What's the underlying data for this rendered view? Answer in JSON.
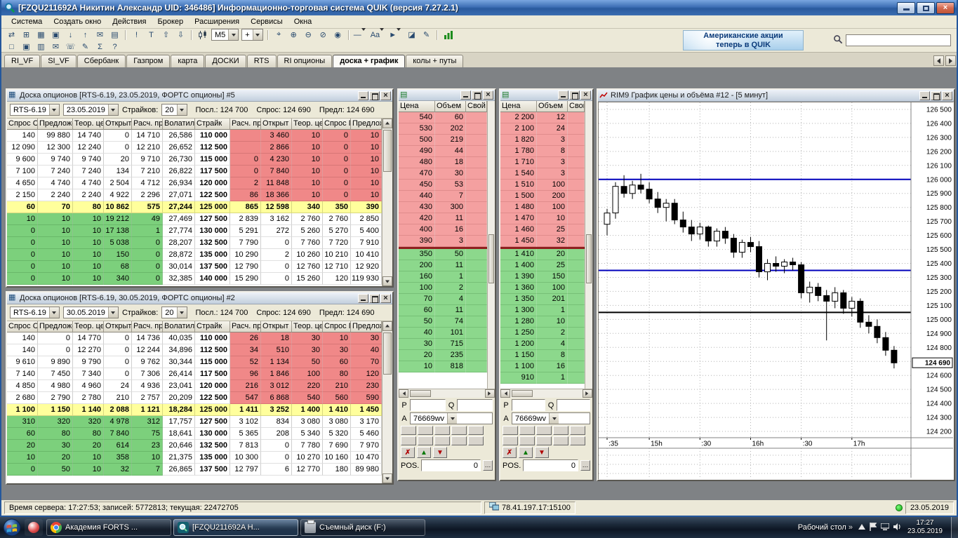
{
  "titlebar": {
    "title": "[FZQU211692A Никитин Александр UID: 346486] Информационно-торговая система QUIK (версия 7.27.2.1)"
  },
  "menubar": [
    "Система",
    "Создать окно",
    "Действия",
    "Брокер",
    "Расширения",
    "Сервисы",
    "Окна"
  ],
  "toolbar": {
    "banner_line1": "Американские акции",
    "banner_line2": "теперь в QUIK",
    "search_placeholder": "",
    "row1": [
      {
        "t": "icon",
        "name": "connection-icon",
        "g": "⇄"
      },
      {
        "t": "icon",
        "name": "new-table-icon",
        "g": "⊞"
      },
      {
        "t": "icon",
        "name": "open-table-icon",
        "g": "▦"
      },
      {
        "t": "icon",
        "name": "save-icon",
        "g": "▣"
      },
      {
        "t": "icon",
        "name": "export-data-icon",
        "g": "↓"
      },
      {
        "t": "icon",
        "name": "import-data-icon",
        "g": "↑"
      },
      {
        "t": "icon",
        "name": "mail-icon",
        "g": "✉"
      },
      {
        "t": "icon",
        "name": "print-icon",
        "g": "▤"
      },
      {
        "t": "sep"
      },
      {
        "t": "icon",
        "name": "info-icon",
        "g": "!"
      },
      {
        "t": "icon",
        "name": "text-format-icon",
        "g": "T"
      },
      {
        "t": "icon",
        "name": "like-icon",
        "g": "⇧"
      },
      {
        "t": "icon",
        "name": "dislike-icon",
        "g": "⇩"
      },
      {
        "t": "sep"
      },
      {
        "t": "svg",
        "name": "candlestick-chart-icon",
        "kind": "candles"
      },
      {
        "t": "combo",
        "name": "interval-select",
        "value": "M5"
      },
      {
        "t": "combo",
        "name": "add-study-select",
        "value": "+"
      },
      {
        "t": "sep"
      },
      {
        "t": "icon",
        "name": "crosshair-icon",
        "g": "⌖"
      },
      {
        "t": "icon",
        "name": "zoom-in-icon",
        "g": "⊕"
      },
      {
        "t": "icon",
        "name": "zoom-out-icon",
        "g": "⊖"
      },
      {
        "t": "icon",
        "name": "zoom-reset-icon",
        "g": "⊘"
      },
      {
        "t": "icon",
        "name": "pan-hand-icon",
        "g": "◉"
      },
      {
        "t": "sep"
      },
      {
        "t": "dropicon",
        "name": "line-tool-icon",
        "g": "—"
      },
      {
        "t": "dropicon",
        "name": "text-tool-icon",
        "g": "Aa"
      },
      {
        "t": "dropicon",
        "name": "pointer-tool-icon",
        "g": "►"
      },
      {
        "t": "icon",
        "name": "eraser-icon",
        "g": "◪"
      },
      {
        "t": "icon",
        "name": "pen-icon",
        "g": "✎"
      },
      {
        "t": "sep"
      },
      {
        "t": "svg",
        "name": "volume-bars-icon",
        "kind": "bars"
      }
    ],
    "row2": [
      {
        "t": "icon",
        "name": "new-window-icon",
        "g": "□"
      },
      {
        "t": "icon",
        "name": "cascade-windows-icon",
        "g": "▣"
      },
      {
        "t": "icon",
        "name": "tile-windows-icon",
        "g": "▥"
      },
      {
        "t": "icon",
        "name": "messages-icon",
        "g": "✉"
      },
      {
        "t": "icon",
        "name": "phone-icon",
        "g": "☏"
      },
      {
        "t": "icon",
        "name": "notes-icon",
        "g": "✎"
      },
      {
        "t": "icon",
        "name": "sum-icon",
        "g": "Σ"
      },
      {
        "t": "icon",
        "name": "help-icon",
        "g": "?"
      }
    ]
  },
  "tabs": [
    "RI_VF",
    "SI_VF",
    "Сбербанк",
    "Газпром",
    "карта",
    "ДОСКИ",
    "RTS",
    "RI опционы",
    "доска + график",
    "колы + путы"
  ],
  "active_tab": "доска + график",
  "boards": [
    {
      "title": "Доска опционов [RTS-6.19, 23.05.2019, ФОРТС опционы] #5",
      "instrument": "RTS-6.19",
      "date": "23.05.2019",
      "strikes_label": "Страйков:",
      "strikes": "20",
      "last_label": "Посл.: 124 700",
      "bid_label": "Спрос: 124 690",
      "ask_label": "Предл: 124 690",
      "headers": [
        "Спрос С.",
        "Предложен",
        "Теор. це",
        "Открыт",
        "Расч. пр",
        "Волатиль",
        "Страйк",
        "Расч. пр",
        "Открыт",
        "Теор. це",
        "Спрос П",
        "Предлож"
      ],
      "atm_index": 6,
      "rows": [
        [
          "140",
          "99 880",
          "14 740",
          "0",
          "14 710",
          "26,586",
          "110 000",
          "",
          "3 460",
          "10",
          "0",
          "10"
        ],
        [
          "12 090",
          "12 300",
          "12 240",
          "0",
          "12 210",
          "26,652",
          "112 500",
          "",
          "2 866",
          "10",
          "0",
          "10"
        ],
        [
          "9 600",
          "9 740",
          "9 740",
          "20",
          "9 710",
          "26,730",
          "115 000",
          "0",
          "4 230",
          "10",
          "0",
          "10"
        ],
        [
          "7 100",
          "7 240",
          "7 240",
          "134",
          "7 210",
          "26,822",
          "117 500",
          "0",
          "7 840",
          "10",
          "0",
          "10"
        ],
        [
          "4 650",
          "4 740",
          "4 740",
          "2 504",
          "4 712",
          "26,934",
          "120 000",
          "2",
          "11 848",
          "10",
          "0",
          "10"
        ],
        [
          "2 150",
          "2 240",
          "2 240",
          "4 922",
          "2 296",
          "27,071",
          "122 500",
          "86",
          "18 366",
          "10",
          "0",
          "10"
        ],
        [
          "60",
          "70",
          "80",
          "10 862",
          "575",
          "27,244",
          "125 000",
          "865",
          "12 598",
          "340",
          "350",
          "390"
        ],
        [
          "10",
          "10",
          "10",
          "19 212",
          "49",
          "27,469",
          "127 500",
          "2 839",
          "3 162",
          "2 760",
          "2 760",
          "2 850"
        ],
        [
          "0",
          "10",
          "10",
          "17 138",
          "1",
          "27,774",
          "130 000",
          "5 291",
          "272",
          "5 260",
          "5 270",
          "5 400"
        ],
        [
          "0",
          "10",
          "10",
          "5 038",
          "0",
          "28,207",
          "132 500",
          "7 790",
          "0",
          "7 760",
          "7 720",
          "7 910"
        ],
        [
          "0",
          "10",
          "10",
          "150",
          "0",
          "28,872",
          "135 000",
          "10 290",
          "2",
          "10 260",
          "10 210",
          "10 410"
        ],
        [
          "0",
          "10",
          "10",
          "68",
          "0",
          "30,014",
          "137 500",
          "12 790",
          "0",
          "12 760",
          "12 710",
          "12 920"
        ],
        [
          "0",
          "10",
          "10",
          "340",
          "0",
          "32,385",
          "140 000",
          "15 290",
          "0",
          "15 260",
          "120",
          "119 930"
        ]
      ]
    },
    {
      "title": "Доска опционов [RTS-6.19, 30.05.2019, ФОРТС опционы] #2",
      "instrument": "RTS-6.19",
      "date": "30.05.2019",
      "strikes_label": "Страйков:",
      "strikes": "20",
      "last_label": "Посл.: 124 700",
      "bid_label": "Спрос: 124 690",
      "ask_label": "Предл: 124 690",
      "headers": [
        "Спрос С.",
        "Предложен",
        "Теор. це",
        "Открыт",
        "Расч. пр",
        "Волатиль",
        "Страйк",
        "Расч. пр",
        "Открыт",
        "Теор. це",
        "Спрос П",
        "Предлож"
      ],
      "atm_index": 6,
      "rows": [
        [
          "140",
          "0",
          "14 770",
          "0",
          "14 736",
          "40,035",
          "110 000",
          "26",
          "18",
          "30",
          "10",
          "30"
        ],
        [
          "140",
          "0",
          "12 270",
          "0",
          "12 244",
          "34,896",
          "112 500",
          "34",
          "510",
          "30",
          "30",
          "40"
        ],
        [
          "9 610",
          "9 890",
          "9 790",
          "0",
          "9 762",
          "30,344",
          "115 000",
          "52",
          "1 134",
          "50",
          "60",
          "70"
        ],
        [
          "7 140",
          "7 450",
          "7 340",
          "0",
          "7 306",
          "26,414",
          "117 500",
          "96",
          "1 846",
          "100",
          "80",
          "120"
        ],
        [
          "4 850",
          "4 980",
          "4 960",
          "24",
          "4 936",
          "23,041",
          "120 000",
          "216",
          "3 012",
          "220",
          "210",
          "230"
        ],
        [
          "2 680",
          "2 790",
          "2 780",
          "210",
          "2 757",
          "20,209",
          "122 500",
          "547",
          "6 868",
          "540",
          "560",
          "590"
        ],
        [
          "1 100",
          "1 150",
          "1 140",
          "2 088",
          "1 121",
          "18,284",
          "125 000",
          "1 411",
          "3 252",
          "1 400",
          "1 410",
          "1 450"
        ],
        [
          "310",
          "320",
          "320",
          "4 978",
          "312",
          "17,757",
          "127 500",
          "3 102",
          "834",
          "3 080",
          "3 080",
          "3 170"
        ],
        [
          "60",
          "80",
          "80",
          "7 840",
          "75",
          "18,641",
          "130 000",
          "5 365",
          "208",
          "5 340",
          "5 320",
          "5 460"
        ],
        [
          "20",
          "30",
          "20",
          "614",
          "23",
          "20,646",
          "132 500",
          "7 813",
          "0",
          "7 780",
          "7 690",
          "7 970"
        ],
        [
          "10",
          "20",
          "10",
          "358",
          "10",
          "21,375",
          "135 000",
          "10 300",
          "0",
          "10 270",
          "10 160",
          "10 470"
        ],
        [
          "0",
          "50",
          "10",
          "32",
          "7",
          "26,865",
          "137 500",
          "12 797",
          "6",
          "12 770",
          "180",
          "89 980"
        ]
      ]
    }
  ],
  "doms": [
    {
      "headers": [
        "Цена",
        "Объем",
        "Свой"
      ],
      "asks": [
        [
          "540",
          "60"
        ],
        [
          "530",
          "202"
        ],
        [
          "500",
          "219"
        ],
        [
          "490",
          "44"
        ],
        [
          "480",
          "18"
        ],
        [
          "470",
          "30"
        ],
        [
          "450",
          "53"
        ],
        [
          "440",
          "7"
        ],
        [
          "430",
          "300"
        ],
        [
          "420",
          "11"
        ],
        [
          "400",
          "16"
        ],
        [
          "390",
          "3"
        ]
      ],
      "bids": [
        [
          "350",
          "50"
        ],
        [
          "200",
          "11"
        ],
        [
          "160",
          "1"
        ],
        [
          "100",
          "2"
        ],
        [
          "70",
          "4"
        ],
        [
          "60",
          "11"
        ],
        [
          "50",
          "74"
        ],
        [
          "40",
          "101"
        ],
        [
          "30",
          "715"
        ],
        [
          "20",
          "235"
        ],
        [
          "10",
          "818"
        ]
      ],
      "p_label": "P",
      "q_label": "Q",
      "a_label": "A",
      "account": "76669wv",
      "pos_label": "POS.",
      "pos_value": "0"
    },
    {
      "headers": [
        "Цена",
        "Объем",
        "Свой"
      ],
      "asks": [
        [
          "2 200",
          "12"
        ],
        [
          "2 100",
          "24"
        ],
        [
          "1 820",
          "3"
        ],
        [
          "1 780",
          "8"
        ],
        [
          "1 710",
          "3"
        ],
        [
          "1 540",
          "3"
        ],
        [
          "1 510",
          "100"
        ],
        [
          "1 500",
          "200"
        ],
        [
          "1 480",
          "100"
        ],
        [
          "1 470",
          "10"
        ],
        [
          "1 460",
          "25"
        ],
        [
          "1 450",
          "32"
        ]
      ],
      "bids": [
        [
          "1 410",
          "20"
        ],
        [
          "1 400",
          "25"
        ],
        [
          "1 390",
          "150"
        ],
        [
          "1 360",
          "100"
        ],
        [
          "1 350",
          "201"
        ],
        [
          "1 300",
          "1"
        ],
        [
          "1 280",
          "10"
        ],
        [
          "1 250",
          "2"
        ],
        [
          "1 200",
          "4"
        ],
        [
          "1 150",
          "8"
        ],
        [
          "1 100",
          "16"
        ],
        [
          "910",
          "1"
        ]
      ],
      "p_label": "P",
      "q_label": "Q",
      "a_label": "A",
      "account": "76669wv",
      "pos_label": "POS.",
      "pos_value": "0"
    }
  ],
  "chart": {
    "type": "candlestick",
    "title": "RIM9 График цены и объёма #12 - [5 минут]",
    "y_ticks": [
      "126 500",
      "126 400",
      "126 300",
      "126 200",
      "126 100",
      "126 000",
      "125 900",
      "125 800",
      "125 700",
      "125 600",
      "125 500",
      "125 400",
      "125 300",
      "125 200",
      "125 100",
      "125 000",
      "124 900",
      "124 800",
      "124 700",
      "124 600",
      "124 500",
      "124 400",
      "124 300",
      "124 200"
    ],
    "x_ticks": [
      {
        "i": 0,
        "label": ":35"
      },
      {
        "i": 5,
        "label": "15h"
      },
      {
        "i": 11,
        "label": ":30"
      },
      {
        "i": 17,
        "label": "16h"
      },
      {
        "i": 23,
        "label": ":30"
      },
      {
        "i": 29,
        "label": "17h"
      }
    ],
    "levels": {
      "blue": [
        126000,
        125350
      ],
      "black": [
        125050
      ]
    },
    "last_price": "124 690",
    "candles": [
      [
        125680,
        125790,
        125600,
        125760
      ],
      [
        125760,
        125980,
        125720,
        125950
      ],
      [
        125950,
        126030,
        125870,
        125900
      ],
      [
        125900,
        125990,
        125860,
        125960
      ],
      [
        125960,
        126040,
        125900,
        125930
      ],
      [
        125930,
        125980,
        125830,
        125860
      ],
      [
        125860,
        125910,
        125760,
        125800
      ],
      [
        125800,
        125860,
        125700,
        125830
      ],
      [
        125830,
        125860,
        125680,
        125710
      ],
      [
        125710,
        125770,
        125620,
        125660
      ],
      [
        125660,
        125710,
        125560,
        125610
      ],
      [
        125610,
        125690,
        125570,
        125660
      ],
      [
        125660,
        125670,
        125520,
        125560
      ],
      [
        125560,
        125650,
        125520,
        125630
      ],
      [
        125630,
        125660,
        125540,
        125580
      ],
      [
        125580,
        125610,
        125440,
        125480
      ],
      [
        125480,
        125570,
        125440,
        125550
      ],
      [
        125550,
        125590,
        125480,
        125520
      ],
      [
        125520,
        125560,
        125300,
        125340
      ],
      [
        125340,
        125430,
        125280,
        125400
      ],
      [
        125400,
        125450,
        125340,
        125380
      ],
      [
        125380,
        125430,
        125330,
        125410
      ],
      [
        125410,
        125440,
        125350,
        125390
      ],
      [
        125390,
        125410,
        125150,
        125190
      ],
      [
        125190,
        125270,
        125120,
        125230
      ],
      [
        125230,
        125260,
        125130,
        125170
      ],
      [
        125170,
        125210,
        124850,
        125130
      ],
      [
        125130,
        125230,
        125080,
        125190
      ],
      [
        125190,
        125210,
        125040,
        125080
      ],
      [
        125080,
        125160,
        125020,
        125130
      ],
      [
        125130,
        125150,
        124940,
        124980
      ],
      [
        124980,
        125030,
        124900,
        124950
      ],
      [
        124950,
        125000,
        124830,
        124870
      ],
      [
        124870,
        124910,
        124740,
        124780
      ],
      [
        124780,
        124810,
        124650,
        124690
      ]
    ]
  },
  "statusbar": {
    "server": "Время сервера: 17:27:53; записей: 5772813; текущая: 22472705",
    "ip": "78.41.197.17:15100",
    "date": "23.05.2019"
  },
  "taskbar": {
    "desktop_label": "Рабочий стол",
    "chevron": "»",
    "time": "17:27",
    "date": "23.05.2019",
    "buttons": [
      {
        "label": "Академия FORTS ...",
        "app": "chrome",
        "active": false
      },
      {
        "label": "[FZQU211692A Н...",
        "app": "quik",
        "active": true
      },
      {
        "label": "Съемный диск (F:)",
        "app": "usb",
        "active": false
      }
    ]
  }
}
